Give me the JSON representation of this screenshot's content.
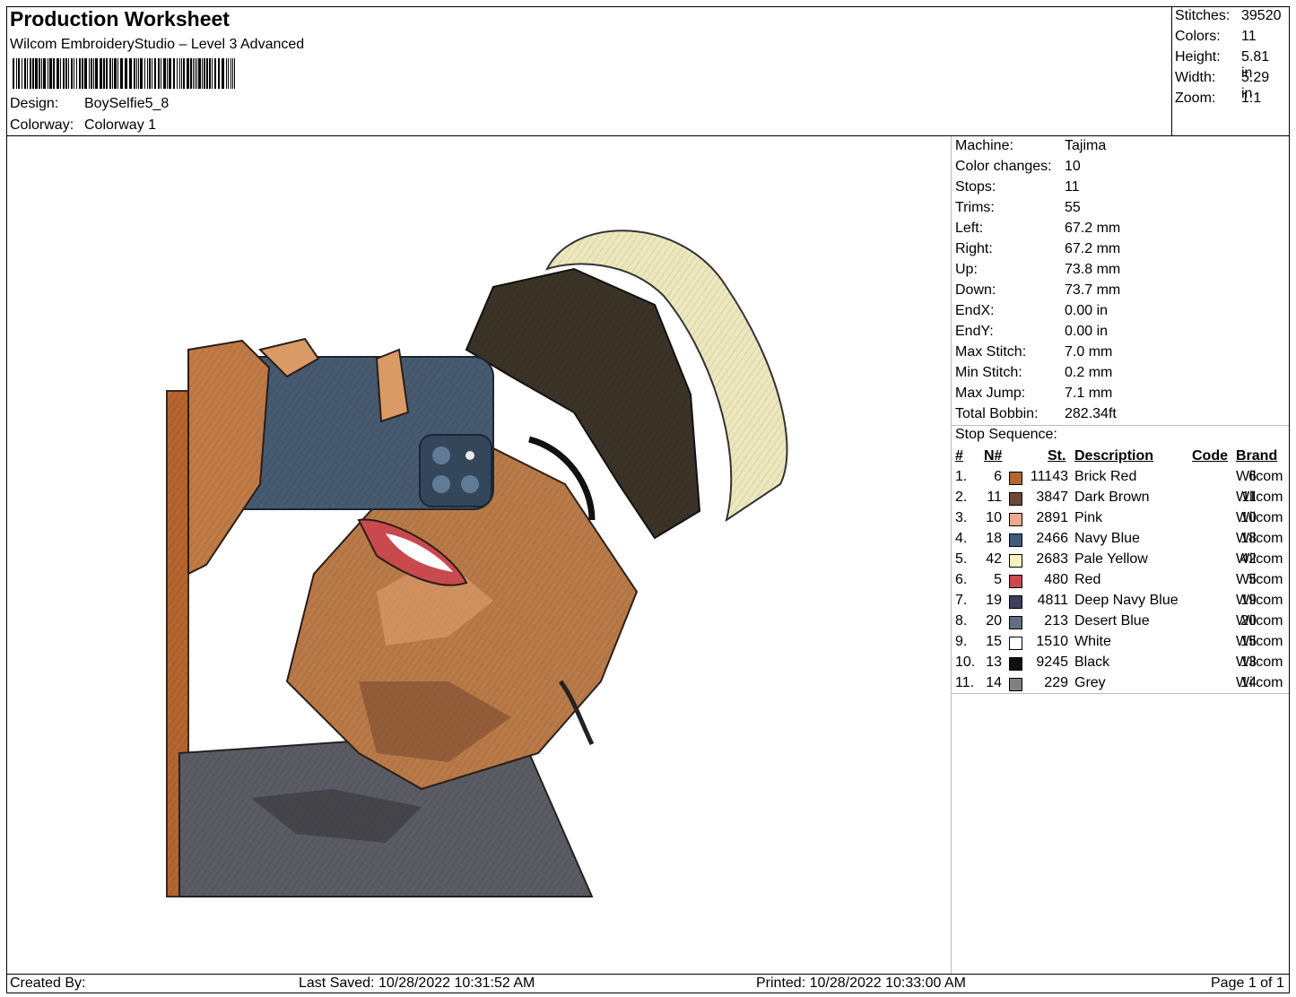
{
  "header": {
    "title": "Production Worksheet",
    "subtitle": "Wilcom EmbroideryStudio – Level 3 Advanced",
    "design_label": "Design:",
    "design_value": "BoySelfie5_8",
    "colorway_label": "Colorway:",
    "colorway_value": "Colorway 1"
  },
  "stats": [
    {
      "label": "Stitches:",
      "value": "39520"
    },
    {
      "label": "Colors:",
      "value": "11"
    },
    {
      "label": "Height:",
      "value": "5.81 in"
    },
    {
      "label": "Width:",
      "value": "5.29 in"
    },
    {
      "label": "Zoom:",
      "value": "1:1"
    }
  ],
  "machine_info": [
    {
      "label": "Machine:",
      "value": "Tajima"
    },
    {
      "label": "Color changes:",
      "value": "10"
    },
    {
      "label": "Stops:",
      "value": "11"
    },
    {
      "label": "Trims:",
      "value": "55"
    },
    {
      "label": "Left:",
      "value": "67.2 mm"
    },
    {
      "label": "Right:",
      "value": "67.2 mm"
    },
    {
      "label": "Up:",
      "value": "73.8 mm"
    },
    {
      "label": "Down:",
      "value": "73.7 mm"
    },
    {
      "label": "EndX:",
      "value": "0.00 in"
    },
    {
      "label": "EndY:",
      "value": "0.00 in"
    },
    {
      "label": "Max Stitch:",
      "value": "7.0 mm"
    },
    {
      "label": "Min Stitch:",
      "value": "0.2 mm"
    },
    {
      "label": "Max Jump:",
      "value": "7.1 mm"
    },
    {
      "label": "Total Bobbin:",
      "value": "282.34ft"
    }
  ],
  "stop_sequence": {
    "title": "Stop Sequence:",
    "headers": {
      "idx": "#",
      "n": "N#",
      "st": "St.",
      "desc": "Description",
      "code": "Code",
      "brand": "Brand"
    },
    "rows": [
      {
        "idx": "1.",
        "n": "6",
        "color": "#b5652e",
        "st": "11143",
        "desc": "Brick Red",
        "code": "6",
        "brand": "Wilcom"
      },
      {
        "idx": "2.",
        "n": "11",
        "color": "#6b4a3c",
        "st": "3847",
        "desc": "Dark Brown",
        "code": "11",
        "brand": "Wilcom"
      },
      {
        "idx": "3.",
        "n": "10",
        "color": "#f2a88a",
        "st": "2891",
        "desc": "Pink",
        "code": "10",
        "brand": "Wilcom"
      },
      {
        "idx": "4.",
        "n": "18",
        "color": "#3f5a7c",
        "st": "2466",
        "desc": "Navy Blue",
        "code": "18",
        "brand": "Wilcom"
      },
      {
        "idx": "5.",
        "n": "42",
        "color": "#f7f1c0",
        "st": "2683",
        "desc": "Pale Yellow",
        "code": "42",
        "brand": "Wilcom"
      },
      {
        "idx": "6.",
        "n": "5",
        "color": "#c94a4e",
        "st": "480",
        "desc": "Red",
        "code": "5",
        "brand": "Wilcom"
      },
      {
        "idx": "7.",
        "n": "19",
        "color": "#3e3f5a",
        "st": "4811",
        "desc": "Deep Navy Blue",
        "code": "19",
        "brand": "Wilcom"
      },
      {
        "idx": "8.",
        "n": "20",
        "color": "#5f6e82",
        "st": "213",
        "desc": "Desert Blue",
        "code": "20",
        "brand": "Wilcom"
      },
      {
        "idx": "9.",
        "n": "15",
        "color": "#ffffff",
        "st": "1510",
        "desc": "White",
        "code": "15",
        "brand": "Wilcom"
      },
      {
        "idx": "10.",
        "n": "13",
        "color": "#111111",
        "st": "9245",
        "desc": "Black",
        "code": "13",
        "brand": "Wilcom"
      },
      {
        "idx": "11.",
        "n": "14",
        "color": "#808080",
        "st": "229",
        "desc": "Grey",
        "code": "14",
        "brand": "Wilcom"
      }
    ]
  },
  "footer": {
    "created_by": "Created By:",
    "last_saved": "Last Saved: 10/28/2022 10:31:52 AM",
    "printed": "Printed: 10/28/2022 10:33:00 AM",
    "page": "Page 1 of 1"
  }
}
